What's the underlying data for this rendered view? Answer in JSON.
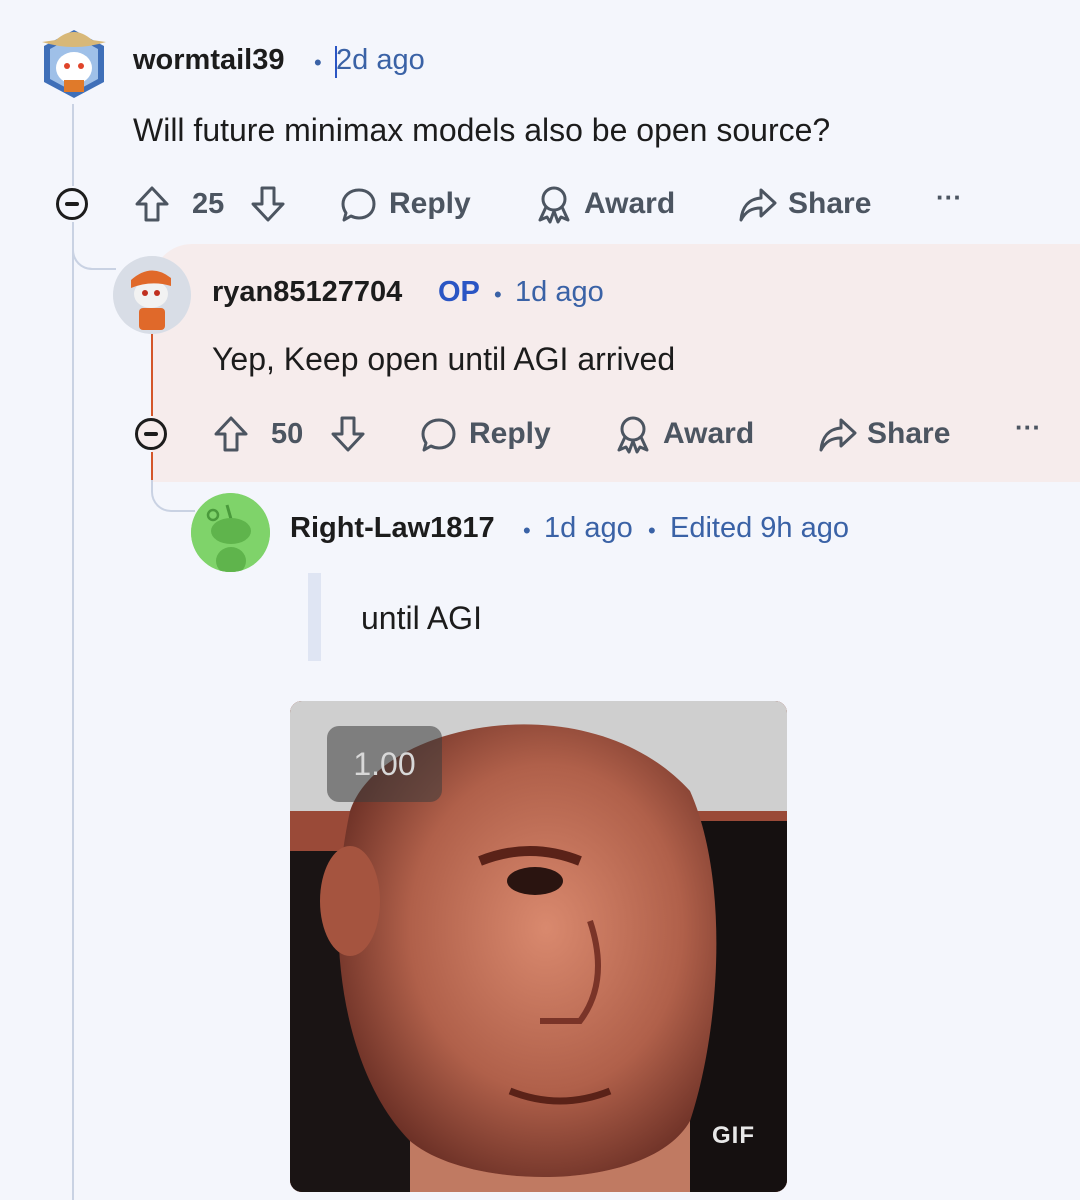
{
  "comments": [
    {
      "username": "wormtail39",
      "time": "2d ago",
      "text": "Will future minimax models also be open source?",
      "votes": "25",
      "actions": {
        "reply": "Reply",
        "award": "Award",
        "share": "Share",
        "more": "···"
      }
    },
    {
      "username": "ryan85127704",
      "op_badge": "OP",
      "time": "1d ago",
      "text": "Yep, Keep open until AGI arrived",
      "votes": "50",
      "actions": {
        "reply": "Reply",
        "award": "Award",
        "share": "Share",
        "more": "···"
      }
    },
    {
      "username": "Right-Law1817",
      "time": "1d ago",
      "edited": "Edited 9h ago",
      "quote": "until AGI",
      "gif": {
        "speed": "1.00",
        "tag": "GIF"
      }
    }
  ],
  "separator": "•",
  "colors": {
    "background": "#f4f6fc",
    "highlight": "#f6ecec",
    "meta_blue": "#3a62a6",
    "op_blue": "#2a55c4",
    "thread_line": "#c9d2e3",
    "op_thread_line": "#d4562a"
  },
  "icons": [
    "upvote-icon",
    "downvote-icon",
    "reply-icon",
    "award-icon",
    "share-icon",
    "collapse-icon",
    "snoo-avatar-icon"
  ]
}
